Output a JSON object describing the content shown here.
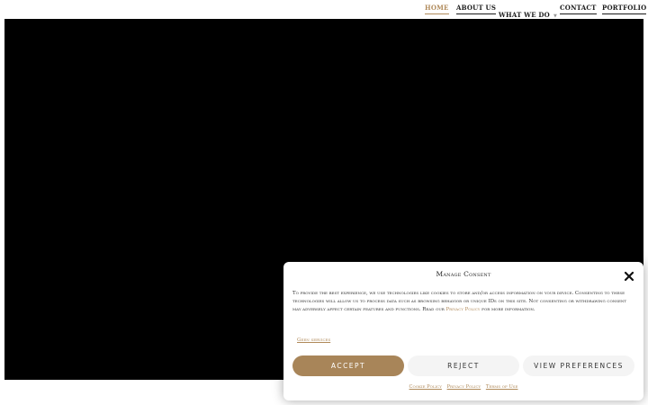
{
  "nav": {
    "items": [
      {
        "label": "Home",
        "active": true
      },
      {
        "label": "About Us"
      },
      {
        "label": "What We Do"
      },
      {
        "label": "Contact"
      },
      {
        "label": "Portfolio"
      }
    ],
    "dropdown_icon": "chevron-down-icon"
  },
  "consent": {
    "title": "Manage Consent",
    "body_text": "To provide the best experience, we use technologies like cookies to store and/or access information on your device. Consenting to these technologies will allow us to process data such as browsing behavior or unique IDs on this site. Not consenting or withdrawing consent may adversely affect certain features and functions. Read our ",
    "privacy_link": "Privacy Policy",
    "body_suffix": " for more information.",
    "deny_link": "Geen services",
    "accept_label": "Accept",
    "reject_label": "Reject",
    "preferences_label": "View preferences",
    "footer_links": [
      "Cookie Policy",
      "Privacy Policy",
      "Terms of Use"
    ],
    "close_icon": "close-icon"
  },
  "colors": {
    "accent": "#a88559",
    "hero_bg": "#000000",
    "nav_text": "#1a1a1a"
  }
}
